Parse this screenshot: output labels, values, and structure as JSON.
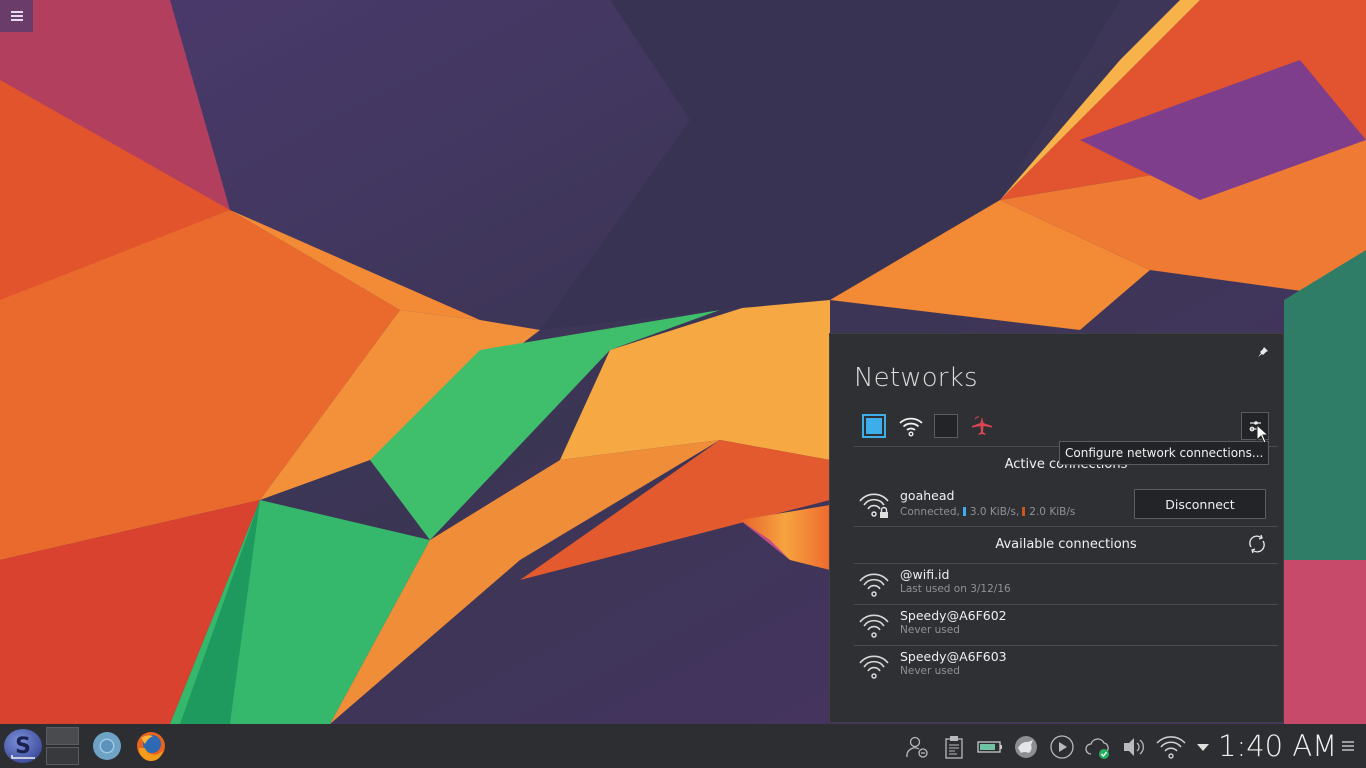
{
  "desktop": {
    "toolbox_icon": "hamburger-menu-icon"
  },
  "networks": {
    "title": "Networks",
    "pin_icon": "pin-icon",
    "toggles": [
      {
        "name": "wired",
        "icon": "ethernet-toggle-icon",
        "enabled": true
      },
      {
        "name": "wireless",
        "icon": "wifi-icon",
        "enabled": true
      },
      {
        "name": "mobile-broadband",
        "icon": "wwan-toggle-icon",
        "enabled": false
      },
      {
        "name": "airplane-mode",
        "icon": "airplane-icon",
        "enabled": false
      }
    ],
    "configure_tooltip": "Configure network connections...",
    "active_heading": "Active connections",
    "active": [
      {
        "name": "goahead",
        "status": "Connected,",
        "download": "3.0 KiB/s,",
        "upload": "2.0 KiB/s",
        "secured": true,
        "action": "Disconnect"
      }
    ],
    "available_heading": "Available connections",
    "available": [
      {
        "name": "@wifi.id",
        "status": "Last used on 3/12/16"
      },
      {
        "name": "Speedy@A6F602",
        "status": "Never used"
      },
      {
        "name": "Speedy@A6F603",
        "status": "Never used"
      }
    ]
  },
  "taskbar": {
    "launcher": "application-launcher-icon",
    "pager_desktops": 2,
    "tasks": [
      "chromium-icon",
      "firefox-icon"
    ],
    "tray": [
      "user-switch-icon",
      "clipboard-icon",
      "battery-icon",
      "konqi-updater-icon",
      "media-player-icon",
      "cloud-sync-icon",
      "volume-icon",
      "wifi-icon",
      "expand-tray-arrow-icon"
    ],
    "clock": "1:40 AM"
  },
  "colors": {
    "accent": "#3daee9",
    "popup_bg": "#2f3033",
    "taskbar_bg": "#2d2e31",
    "airplane": "#da4453",
    "upload_rate": "#c8571f"
  }
}
